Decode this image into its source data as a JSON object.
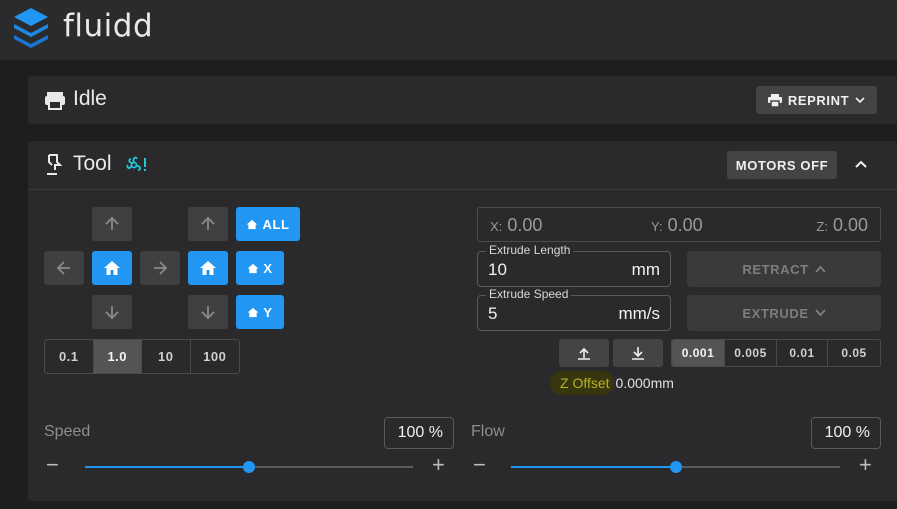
{
  "app": {
    "name": "fluidd"
  },
  "status_card": {
    "title": "Idle",
    "reprint_label": "REPRINT"
  },
  "tool_card": {
    "title": "Tool",
    "motors_off_label": "MOTORS OFF",
    "home_all_label": "ALL",
    "home_x_label": "X",
    "home_y_label": "Y",
    "jog_steps": [
      "0.1",
      "1.0",
      "10",
      "100"
    ],
    "jog_step_selected": "1.0",
    "position": {
      "x_label": "X:",
      "x": "0.00",
      "y_label": "Y:",
      "y": "0.00",
      "z_label": "Z:",
      "z": "0.00"
    },
    "extrude_length": {
      "label": "Extrude Length",
      "value": "10",
      "unit": "mm"
    },
    "extrude_speed": {
      "label": "Extrude Speed",
      "value": "5",
      "unit": "mm/s"
    },
    "retract_label": "RETRACT",
    "extrude_label": "EXTRUDE",
    "z_steps": [
      "0.001",
      "0.005",
      "0.01",
      "0.05"
    ],
    "z_step_selected": "0.001",
    "z_offset_label": "Z Offset",
    "z_offset_value": "0.000mm",
    "speed": {
      "label": "Speed",
      "value": "100 %",
      "fraction": 0.5
    },
    "flow": {
      "label": "Flow",
      "value": "100 %",
      "fraction": 0.5
    }
  },
  "colors": {
    "accent": "#2196f3",
    "card": "#2a2a2c",
    "background": "#1e1e1f"
  },
  "icons": [
    "fluidd-logo-icon",
    "printer-icon",
    "tool-icon",
    "fan-warning-icon",
    "chevron-down-icon",
    "chevron-up-icon",
    "arrow-up-icon",
    "arrow-down-icon",
    "arrow-left-icon",
    "arrow-right-icon",
    "home-icon"
  ]
}
